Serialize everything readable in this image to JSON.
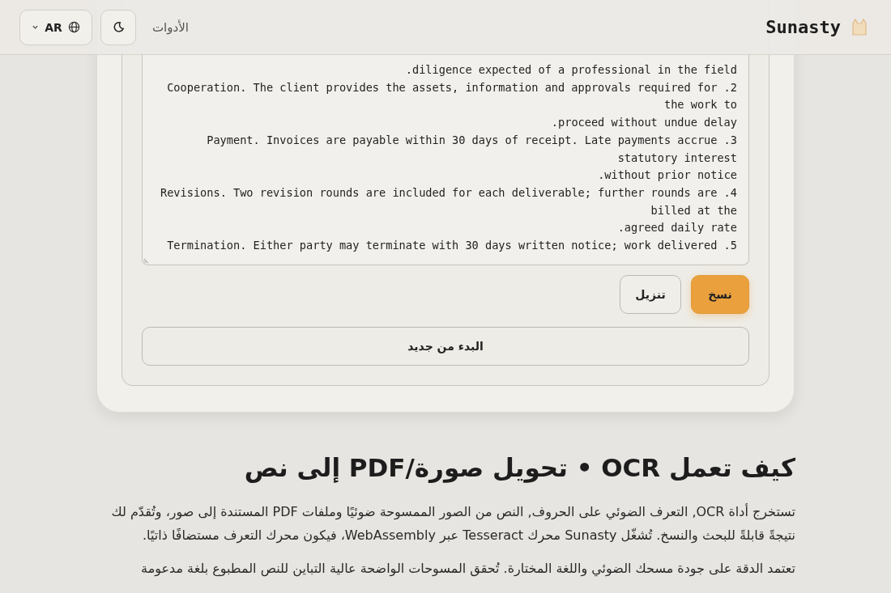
{
  "header": {
    "logo": "Sunasty",
    "nav_link": "الأدوات",
    "language": "AR"
  },
  "result_lines": [
    "diligence expected of a professional in the field.",
    "2. Cooperation. The client provides the assets, information and approvals required for",
    "the work to",
    "proceed without undue delay.",
    "3. Payment. Invoices are payable within 30 days of receipt. Late payments accrue",
    "statutory interest",
    "without prior notice.",
    "4. Revisions. Two revision rounds are included for each deliverable; further rounds are",
    "billed at the",
    "agreed daily rate.",
    "5. Termination. Either party may terminate with 30 days written notice; work delivered"
  ],
  "actions": [
    {
      "label": "نسخ",
      "kind": "primary"
    },
    {
      "label": "تنزيل",
      "kind": "secondary"
    }
  ],
  "restart_button": "البدء من جديد",
  "article": {
    "title": "كيف تعمل OCR • تحويل صورة/PDF إلى نص",
    "paragraphs": [
      "تستخرج أداة OCR, التعرف الضوئي على الحروف, النص من الصور الممسوحة ضوئيًا وملفات PDF المستندة إلى صور، وتُقدّم لك نتيجةً قابلةً للبحث والنسخ. تُشغّل Sunasty محرك Tesseract عبر WebAssembly، فيكون محرك التعرف مستضافًا ذاتيًا.",
      "تعتمد الدقة على جودة مسحك الضوئي واللغة المختارة. تُحقق المسوحات الواضحة عالية التباين للنص المطبوع بلغة مدعومة"
    ]
  }
}
